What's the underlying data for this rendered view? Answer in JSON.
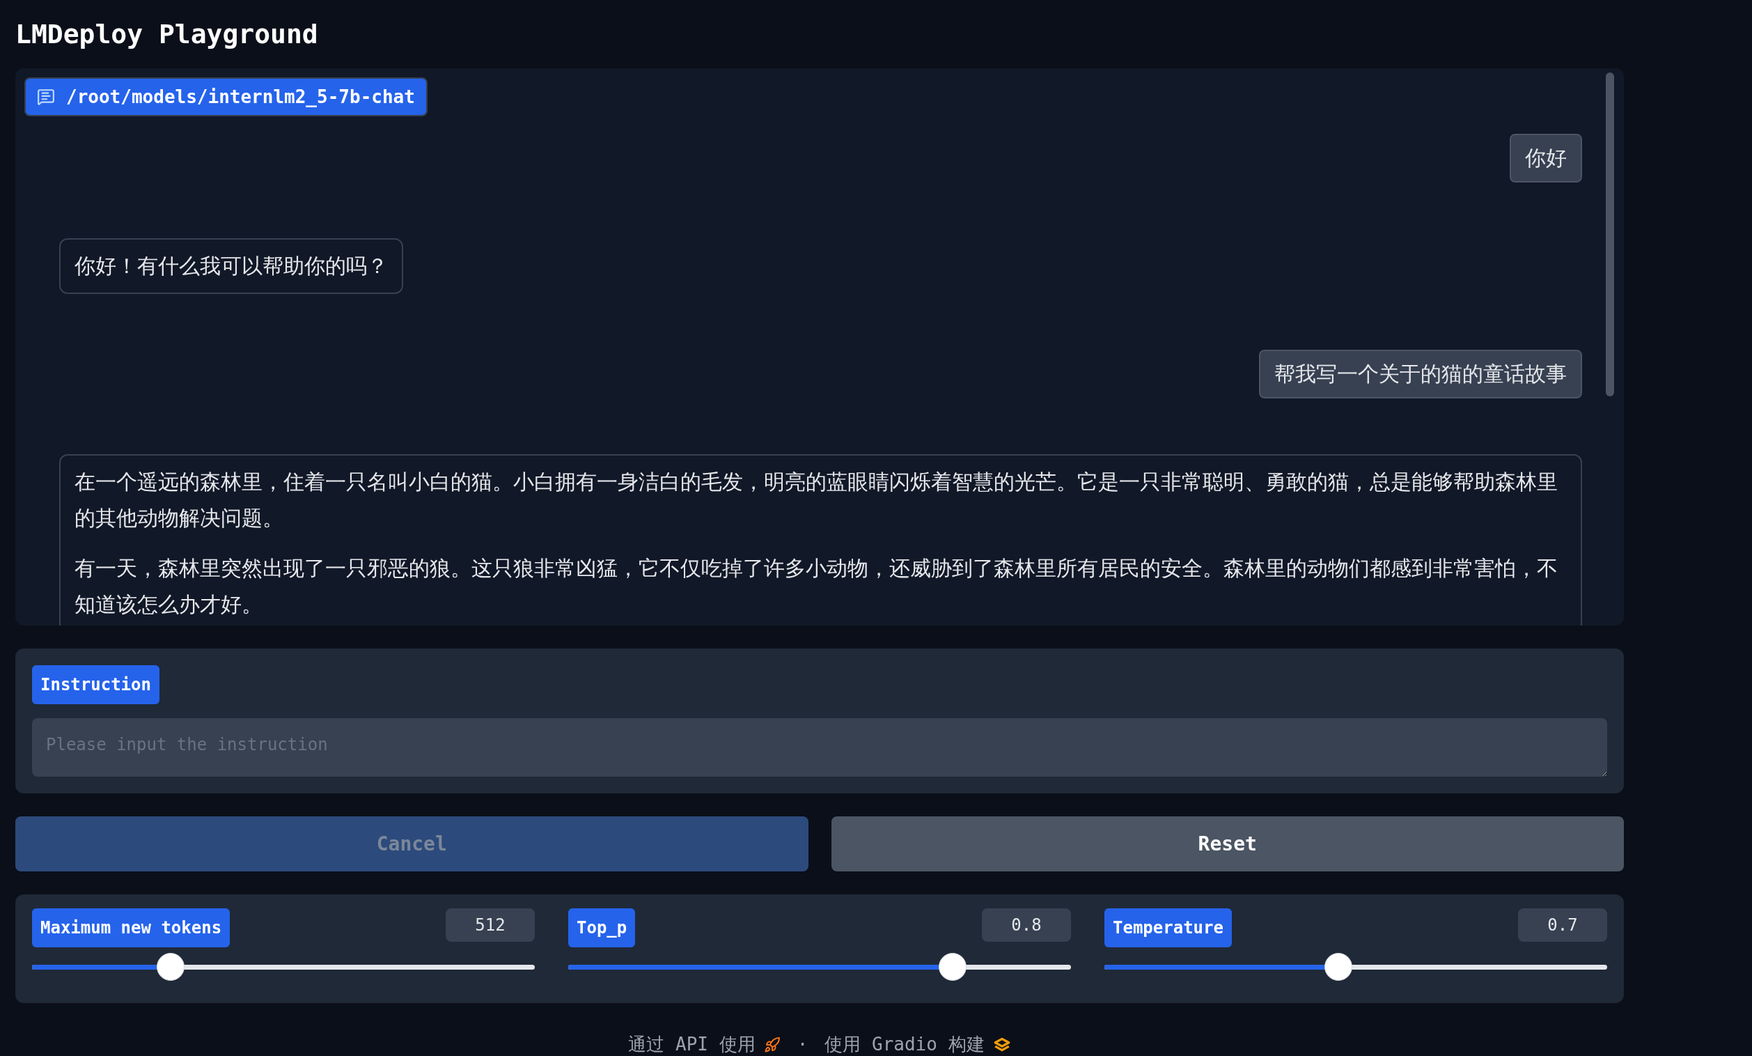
{
  "title": "LMDeploy Playground",
  "chatbot": {
    "label": "/root/models/internlm2_5-7b-chat",
    "messages": [
      {
        "kind": "user",
        "paragraphs": [
          "你好"
        ]
      },
      {
        "kind": "bot",
        "paragraphs": [
          "你好！有什么我可以帮助你的吗？"
        ]
      },
      {
        "kind": "user",
        "paragraphs": [
          "帮我写一个关于的猫的童话故事"
        ]
      },
      {
        "kind": "bot",
        "paragraphs": [
          "在一个遥远的森林里，住着一只名叫小白的猫。小白拥有一身洁白的毛发，明亮的蓝眼睛闪烁着智慧的光芒。它是一只非常聪明、勇敢的猫，总是能够帮助森林里的其他动物解决问题。",
          "有一天，森林里突然出现了一只邪恶的狼。这只狼非常凶猛，它不仅吃掉了许多小动物，还威胁到了森林里所有居民的安全。森林里的动物们都感到非常害怕，不知道该怎么办才好。"
        ]
      }
    ]
  },
  "instruction": {
    "label": "Instruction",
    "placeholder": "Please input the instruction"
  },
  "buttons": [
    {
      "label": "Cancel",
      "kind": "primary",
      "disabled": true
    },
    {
      "label": "Reset",
      "kind": "secondary",
      "disabled": false
    }
  ],
  "sliders": [
    {
      "label": "Maximum new tokens",
      "value": "512",
      "level": 0.262
    },
    {
      "label": "Top_p",
      "value": "0.8",
      "level": 0.78
    },
    {
      "label": "Temperature",
      "value": "0.7",
      "level": 0.464
    }
  ],
  "footer": {
    "api_text": "通过 API 使用",
    "separator": "·",
    "built_text": "使用 Gradio 构建"
  }
}
